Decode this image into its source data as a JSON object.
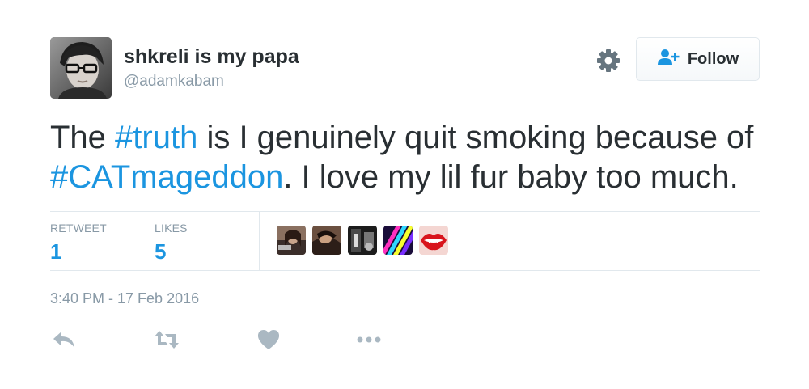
{
  "user": {
    "display_name": "shkreli is my papa",
    "handle": "@adamkabam"
  },
  "header": {
    "follow_label": "Follow",
    "settings_icon": "gear-icon",
    "follow_icon": "add-user-icon"
  },
  "tweet": {
    "text_parts": [
      {
        "type": "text",
        "value": "The "
      },
      {
        "type": "hashtag",
        "value": "#truth"
      },
      {
        "type": "text",
        "value": " is I genuinely quit smoking because of "
      },
      {
        "type": "hashtag",
        "value": "#CATmageddon"
      },
      {
        "type": "text",
        "value": ". I love my lil fur baby too much."
      }
    ]
  },
  "stats": {
    "retweet_label": "RETWEET",
    "retweet_count": "1",
    "likes_label": "LIKES",
    "likes_count": "5"
  },
  "likers_count": 5,
  "timestamp": "3:40 PM - 17 Feb 2016",
  "actions": [
    {
      "name": "reply",
      "icon": "reply-icon"
    },
    {
      "name": "retweet",
      "icon": "retweet-icon"
    },
    {
      "name": "like",
      "icon": "heart-icon"
    },
    {
      "name": "more",
      "icon": "more-icon"
    }
  ],
  "colors": {
    "link": "#1b95e0",
    "muted": "#8899a6",
    "text": "#292f33",
    "border": "#e1e8ed"
  }
}
